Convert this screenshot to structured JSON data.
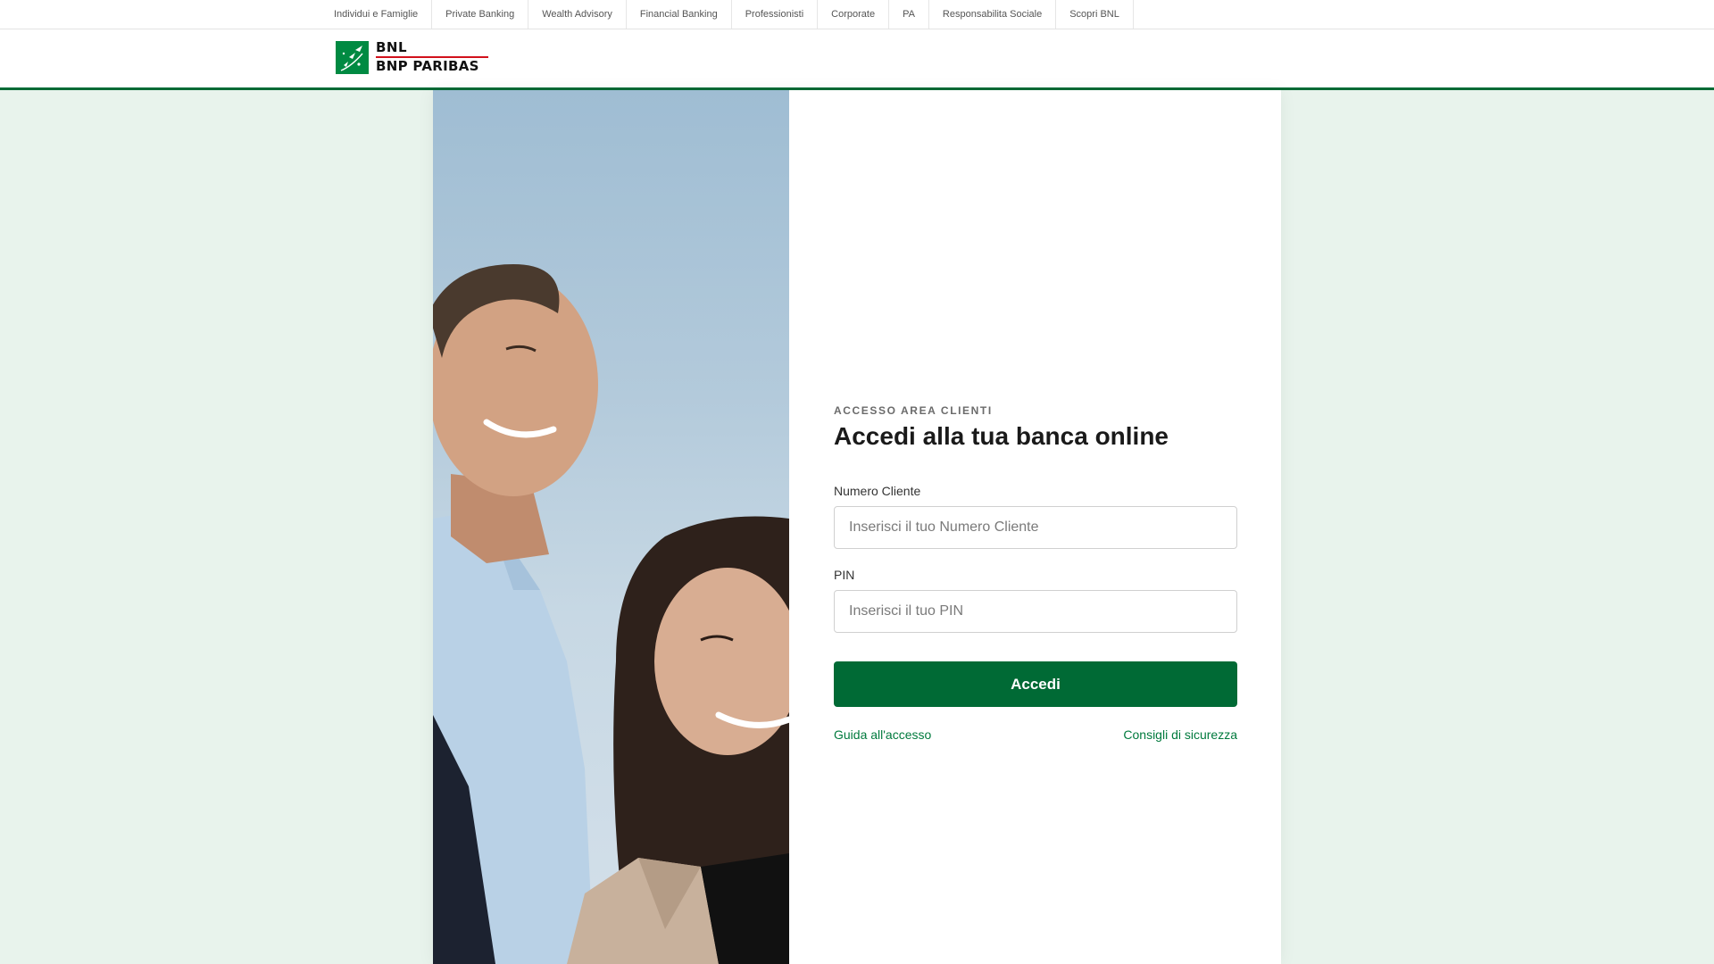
{
  "topnav": {
    "items": [
      {
        "label": "Individui e Famiglie"
      },
      {
        "label": "Private Banking"
      },
      {
        "label": "Wealth Advisory"
      },
      {
        "label": "Financial Banking"
      },
      {
        "label": "Professionisti"
      },
      {
        "label": "Corporate"
      },
      {
        "label": "PA"
      },
      {
        "label": "Responsabilita Sociale"
      },
      {
        "label": "Scopri BNL"
      }
    ]
  },
  "header": {
    "logo_line1": "BNL",
    "logo_line2": "BNP PARIBAS"
  },
  "login": {
    "eyebrow": "ACCESSO AREA CLIENTI",
    "title": "Accedi alla tua banca online",
    "client_label": "Numero Cliente",
    "client_placeholder": "Inserisci il tuo Numero Cliente",
    "pin_label": "PIN",
    "pin_placeholder": "Inserisci il tuo PIN",
    "submit_label": "Accedi",
    "help_link": "Guida all'accesso",
    "security_link": "Consigli di sicurezza"
  },
  "colors": {
    "brand_green": "#006a35",
    "logo_green": "#008a42",
    "logo_red": "#d2111c",
    "page_background": "#e8f3ec",
    "link_green": "#007a3d"
  },
  "icons": {
    "logo_mark": "bnp-paribas-stars-icon"
  }
}
